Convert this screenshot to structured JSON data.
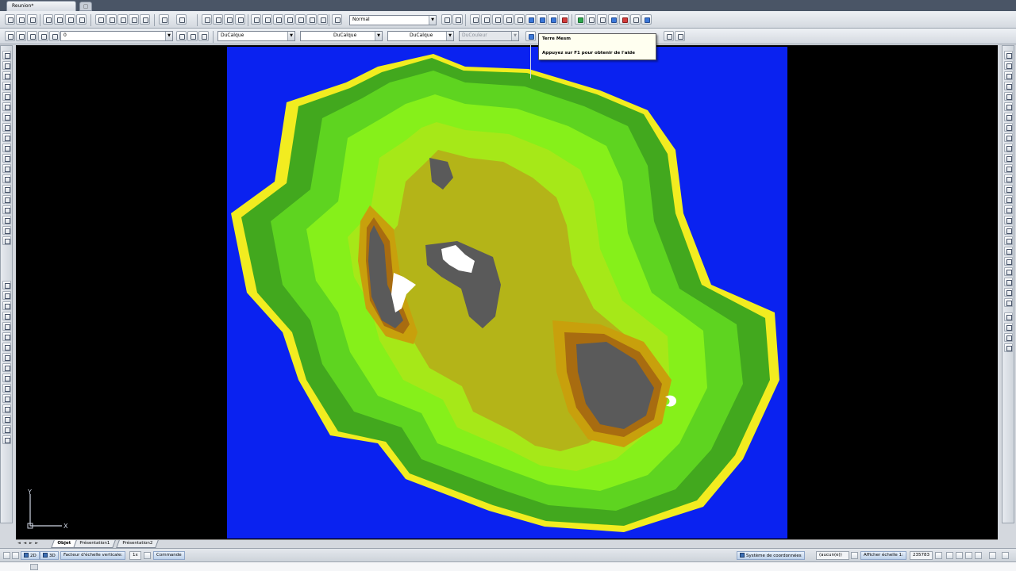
{
  "window": {
    "document_tab": "Reunion*"
  },
  "toolbar": {
    "named_view_combo": "Normal",
    "layer_combo": "0",
    "color_combo": "DuCalque",
    "linetype_combo": "DuCalque",
    "lineweight_combo": "DuCalque",
    "plotstyle_combo": "DuCouleur"
  },
  "tooltip": {
    "title": "Terre Mesm",
    "help": "Appuyez sur F1 pour obtenir de l'aide"
  },
  "layout_tabs": {
    "nav_arrows": "◄ ◄ ► ►",
    "items": [
      {
        "label": "Objet",
        "active": true
      },
      {
        "label": "Présentation1",
        "active": false
      },
      {
        "label": "Présentation2",
        "active": false
      }
    ]
  },
  "status_bar": {
    "mode_2d": "2D",
    "mode_3d": "3D",
    "vertical_scale_label": "Facteur d'échelle verticale:",
    "vertical_scale_value": "1x",
    "command_label": "Commande",
    "coord_system_label": "Système de coordonnées",
    "coord_system_value": "(aucun(e))",
    "scale_label": "Afficher échelle 1:",
    "scale_value": "235783"
  },
  "map": {
    "colors": {
      "sea": "#0a22f0",
      "beach": "#f2ec20",
      "coast_dark_green": "#42a81e",
      "green": "#5ed420",
      "light_green": "#86f01a",
      "lime": "#a6e818",
      "olive": "#b4b418",
      "ochre": "#c8a00c",
      "brown": "#a86c10",
      "summit_grey": "#5a5a5a",
      "peak_white": "#ffffff"
    }
  },
  "ucs": {
    "y_label": "Y",
    "x_label": "X"
  }
}
